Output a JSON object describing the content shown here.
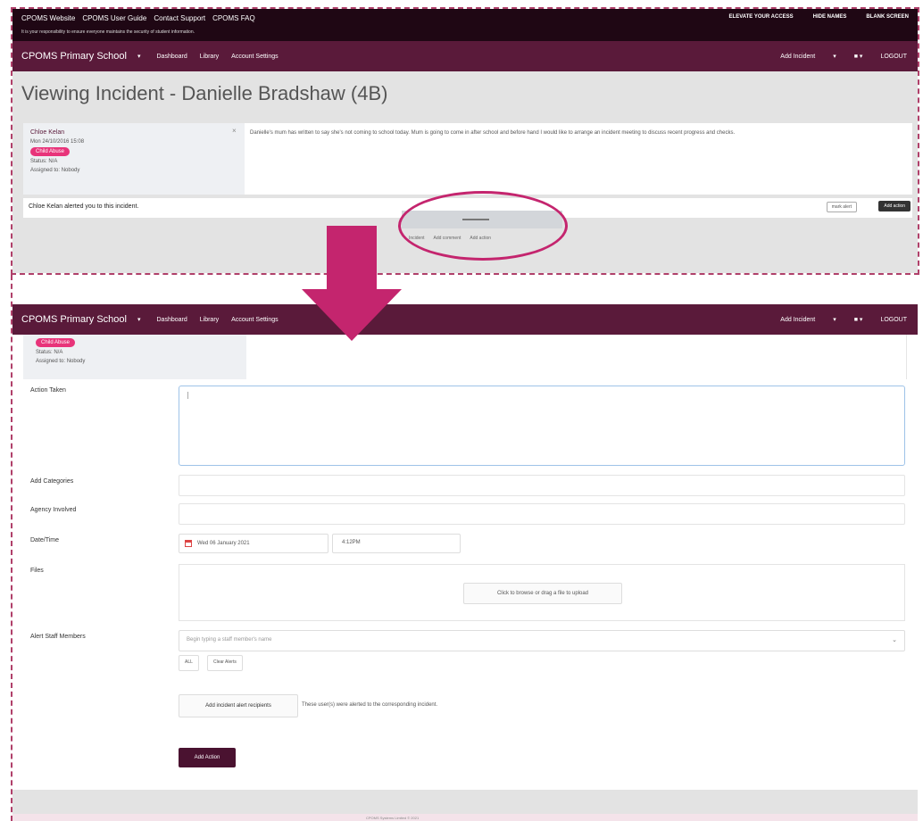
{
  "utility_bar": {
    "links": [
      "CPOMS Website",
      "CPOMS User Guide",
      "Contact Support",
      "CPOMS FAQ"
    ],
    "note": "It is your responsibility to ensure everyone maintains the security of student information.",
    "right": [
      "ELEVATE YOUR ACCESS",
      "HIDE NAMES",
      "BLANK SCREEN"
    ]
  },
  "nav": {
    "brand": "CPOMS Primary School",
    "caret": "▾",
    "items": [
      "Dashboard",
      "Library",
      "Account Settings"
    ],
    "add_incident": "Add Incident",
    "add_caret": "▾",
    "user_caret": "▾",
    "logout": "LOGOUT"
  },
  "page": {
    "title": "Viewing Incident - Danielle Bradshaw (4B)"
  },
  "incident": {
    "author": "Chloe Kelan",
    "date": "Mon 24/10/2016 15:08",
    "badge": "Child Abuse",
    "status": "Status: N/A",
    "assigned": "Assigned to: Nobody",
    "close": "×",
    "description": "Danielle's mum has written to say she's not coming to school today. Mum is going to come in after school and before hand I would like to arrange an incident meeting to discuss recent progress and checks."
  },
  "alert": {
    "text": "Chloe Kelan alerted you to this incident.",
    "mark_button": "mark alert",
    "dark_button": "Add action"
  },
  "mid_actions": [
    "Incident",
    "Add comment",
    "Add action"
  ],
  "form": {
    "meta_badge": "Child Abuse",
    "meta_status": "Status: N/A",
    "meta_assigned": "Assigned to: Nobody",
    "labels": {
      "action_taken": "Action Taken",
      "add_categories": "Add Categories",
      "agency_involved": "Agency Involved",
      "date_time": "Date/Time",
      "files": "Files",
      "alert_staff": "Alert Staff Members"
    },
    "date_value": "Wed 06 January 2021",
    "time_value": "4:12PM",
    "upload_label": "Click to browse or drag a file to upload",
    "staff_placeholder": "Begin typing a staff member's name",
    "staff_chevron": "⌄",
    "btn_all": "ALL",
    "btn_none": "Clear Alerts",
    "recipients_button": "Add incident alert recipients",
    "recipients_note": "These user(s) were alerted to the corresponding incident.",
    "add_action": "Add Action"
  },
  "footer": {
    "text": "CPOMS Systems Limited © 2021"
  },
  "colors": {
    "utility": "#1f0714",
    "nav": "#5a1a3a",
    "accent": "#c4256e",
    "badge": "#e8347a"
  }
}
